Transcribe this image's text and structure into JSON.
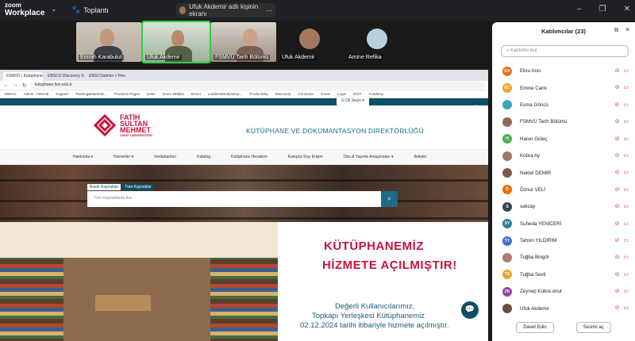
{
  "zoom": {
    "app_line1": "zoom",
    "app_line2": "Workplace",
    "meeting_label": "Toplantı",
    "share_label": "Ufuk Akdemir adlı kişinin ekranı"
  },
  "videos": [
    {
      "name": "Emrah Karabulut"
    },
    {
      "name": "Ufuk Akdemir"
    },
    {
      "name": "FSMVÜ Tarih Bölümü"
    },
    {
      "name": "Ufuk Akdemir"
    },
    {
      "name": "Amine Refika"
    }
  ],
  "browser": {
    "tabs": [
      "FSMVÜ | Kütüphane ve Doküm",
      "EBSCO Discovery Service",
      "EBSCOadmin > Personel User"
    ],
    "url": "kutuphane.fsm.edu.tr",
    "bookmarks": [
      "Metrics",
      "Admin - Internal",
      "Support",
      "Training&Marketin...",
      "Products Pages",
      "Links",
      "Zoom Webiks",
      "Demo",
      "Leaders&Sub(samp...",
      "Productivity",
      "Discovery",
      "Consortia",
      "Travel",
      "Login",
      "EDIT",
      "Academy"
    ]
  },
  "site": {
    "lang_button": "Dil Seçin",
    "brand_l1": "FATİH",
    "brand_l2": "SULTAN",
    "brand_l3": "MEHMET",
    "brand_l4": "VAKIF ÜNİVERSİTESİ",
    "title": "KÜTÜPHANE VE DOKÜMANTASYON DİREKTÖRLÜĞÜ",
    "menu": [
      "Hakkında ▾",
      "Hizmetler ▾",
      "Veritabanları",
      "Katalog",
      "Kütüphane Hesabım",
      "Kampüs Dışı Erişim",
      "Oku & Yayınla Anlaşmaları ▾",
      "İletişim"
    ],
    "search_tab1": "Basılı Kaynaklar",
    "search_tab2": "Tüm Kaynaklar",
    "search_placeholder": "Tüm Kaynaklarda Ara",
    "banner_l1": "KÜTÜPHANEMİZ",
    "banner_l2": "HİZMETE AÇILMIŞTIR!",
    "banner_l3": "Değerli Kullanıcılarımız,",
    "banner_l4": "Topkapı Yerleşkesi Kütüphanemiz",
    "banner_l5": "02.12.2024 tarihi itibariyle hizmete açılmıştır."
  },
  "participants": {
    "title": "Katılımcılar (23)",
    "search_placeholder": "Katılımcı bul",
    "list": [
      {
        "initials": "EA",
        "name": "Ebru Ancı",
        "color": "#e8711a",
        "cam": "off"
      },
      {
        "initials": "EC",
        "name": "Emine Canlı",
        "color": "#f0a22e",
        "cam": "off"
      },
      {
        "initials": "",
        "name": "Esma Göncü",
        "color": "#3aa5b8",
        "cam": "off"
      },
      {
        "initials": "",
        "name": "FSMVÜ Tarih Bölümü",
        "color": "#8b6b58",
        "cam": "on"
      },
      {
        "initials": "H",
        "name": "Hacer Güleç",
        "color": "#4caf50",
        "cam": "off"
      },
      {
        "initials": "",
        "name": "Kübra Ay",
        "color": "#a07860",
        "cam": "off"
      },
      {
        "initials": "",
        "name": "Nektel DEMİR",
        "color": "#7a5a4a",
        "cam": "off"
      },
      {
        "initials": "Ö",
        "name": "Öznur VELİ",
        "color": "#ef6c00",
        "cam": "off"
      },
      {
        "initials": "S",
        "name": "sakcay",
        "color": "#37474f",
        "cam": "off"
      },
      {
        "initials": "SY",
        "name": "Suheda YENİCERİ",
        "color": "#2e7d9a",
        "cam": "off"
      },
      {
        "initials": "TY",
        "name": "Tahsin YILDIRIM",
        "color": "#3f6fd1",
        "cam": "off"
      },
      {
        "initials": "",
        "name": "Tuğba Bingöl",
        "color": "#b07a68",
        "cam": "off"
      },
      {
        "initials": "TS",
        "name": "Tuğba Sevil",
        "color": "#f0a22e",
        "cam": "off"
      },
      {
        "initials": "ZK",
        "name": "Zeynep Kübra onur",
        "color": "#8e44ad",
        "cam": "off"
      },
      {
        "initials": "",
        "name": "Ufuk Akdemir",
        "color": "#6d4c41",
        "cam": "on"
      }
    ],
    "invite_button": "Davet Edin",
    "mute_all_button": "Sesimi aç"
  }
}
